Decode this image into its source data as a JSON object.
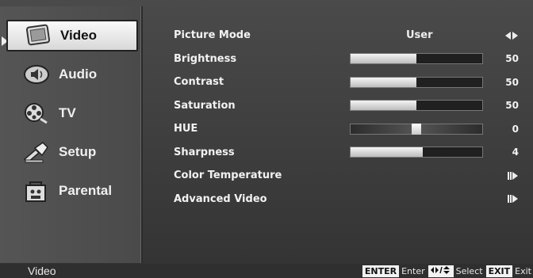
{
  "sidebar": {
    "items": [
      {
        "label": "Video",
        "icon": "video-icon",
        "selected": true
      },
      {
        "label": "Audio",
        "icon": "speaker-icon",
        "selected": false
      },
      {
        "label": "TV",
        "icon": "film-reel-icon",
        "selected": false
      },
      {
        "label": "Setup",
        "icon": "tools-icon",
        "selected": false
      },
      {
        "label": "Parental",
        "icon": "parental-lock-icon",
        "selected": false
      }
    ]
  },
  "menu": {
    "picture_mode": {
      "label": "Picture Mode",
      "value": "User"
    },
    "brightness": {
      "label": "Brightness",
      "value": "50",
      "level": 0.5
    },
    "contrast": {
      "label": "Contrast",
      "value": "50",
      "level": 0.5
    },
    "saturation": {
      "label": "Saturation",
      "value": "50",
      "level": 0.5
    },
    "hue": {
      "label": "HUE",
      "value": "0",
      "level": 0.5
    },
    "sharpness": {
      "label": "Sharpness",
      "value": "4",
      "level": 0.55
    },
    "color_temperature": {
      "label": "Color Temperature"
    },
    "advanced_video": {
      "label": "Advanced Video"
    }
  },
  "footer": {
    "title": "Video",
    "enter_key": "ENTER",
    "enter_label": "Enter",
    "select_label": "Select",
    "exit_key": "EXIT",
    "exit_label": "Exit"
  }
}
